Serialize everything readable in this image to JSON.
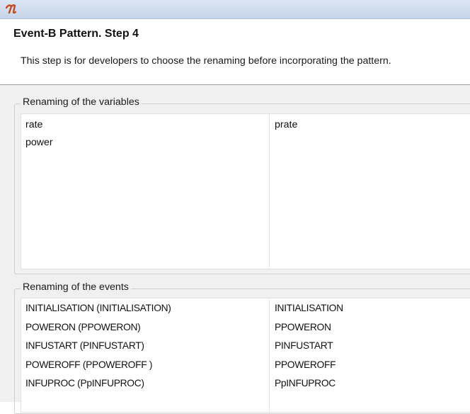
{
  "window": {
    "icon": "event-b-wizard-icon"
  },
  "header": {
    "title": "Event-B Pattern. Step 4",
    "description": "This step is for developers to choose the renaming before incorporating the pattern."
  },
  "variables_group": {
    "label": "Renaming of the variables",
    "rows": [
      {
        "original": "rate",
        "renamed": "prate"
      },
      {
        "original": "power",
        "renamed": ""
      }
    ]
  },
  "events_group": {
    "label": "Renaming of the events",
    "rows": [
      {
        "original": "INITIALISATION (INITIALISATION)",
        "renamed": "INITIALISATION"
      },
      {
        "original": "POWERON (PPOWERON)",
        "renamed": "PPOWERON"
      },
      {
        "original": "INFUSTART (PINFUSTART)",
        "renamed": "PINFUSTART"
      },
      {
        "original": "POWEROFF  (PPOWEROFF )",
        "renamed": "PPOWEROFF"
      },
      {
        "original": "INFUPROC (PpINFUPROC)",
        "renamed": "PpINFUPROC"
      }
    ]
  },
  "colors": {
    "title_bar": "#c6d5ea",
    "background": "#f0f0f0",
    "icon_accent": "#c44a1c"
  }
}
